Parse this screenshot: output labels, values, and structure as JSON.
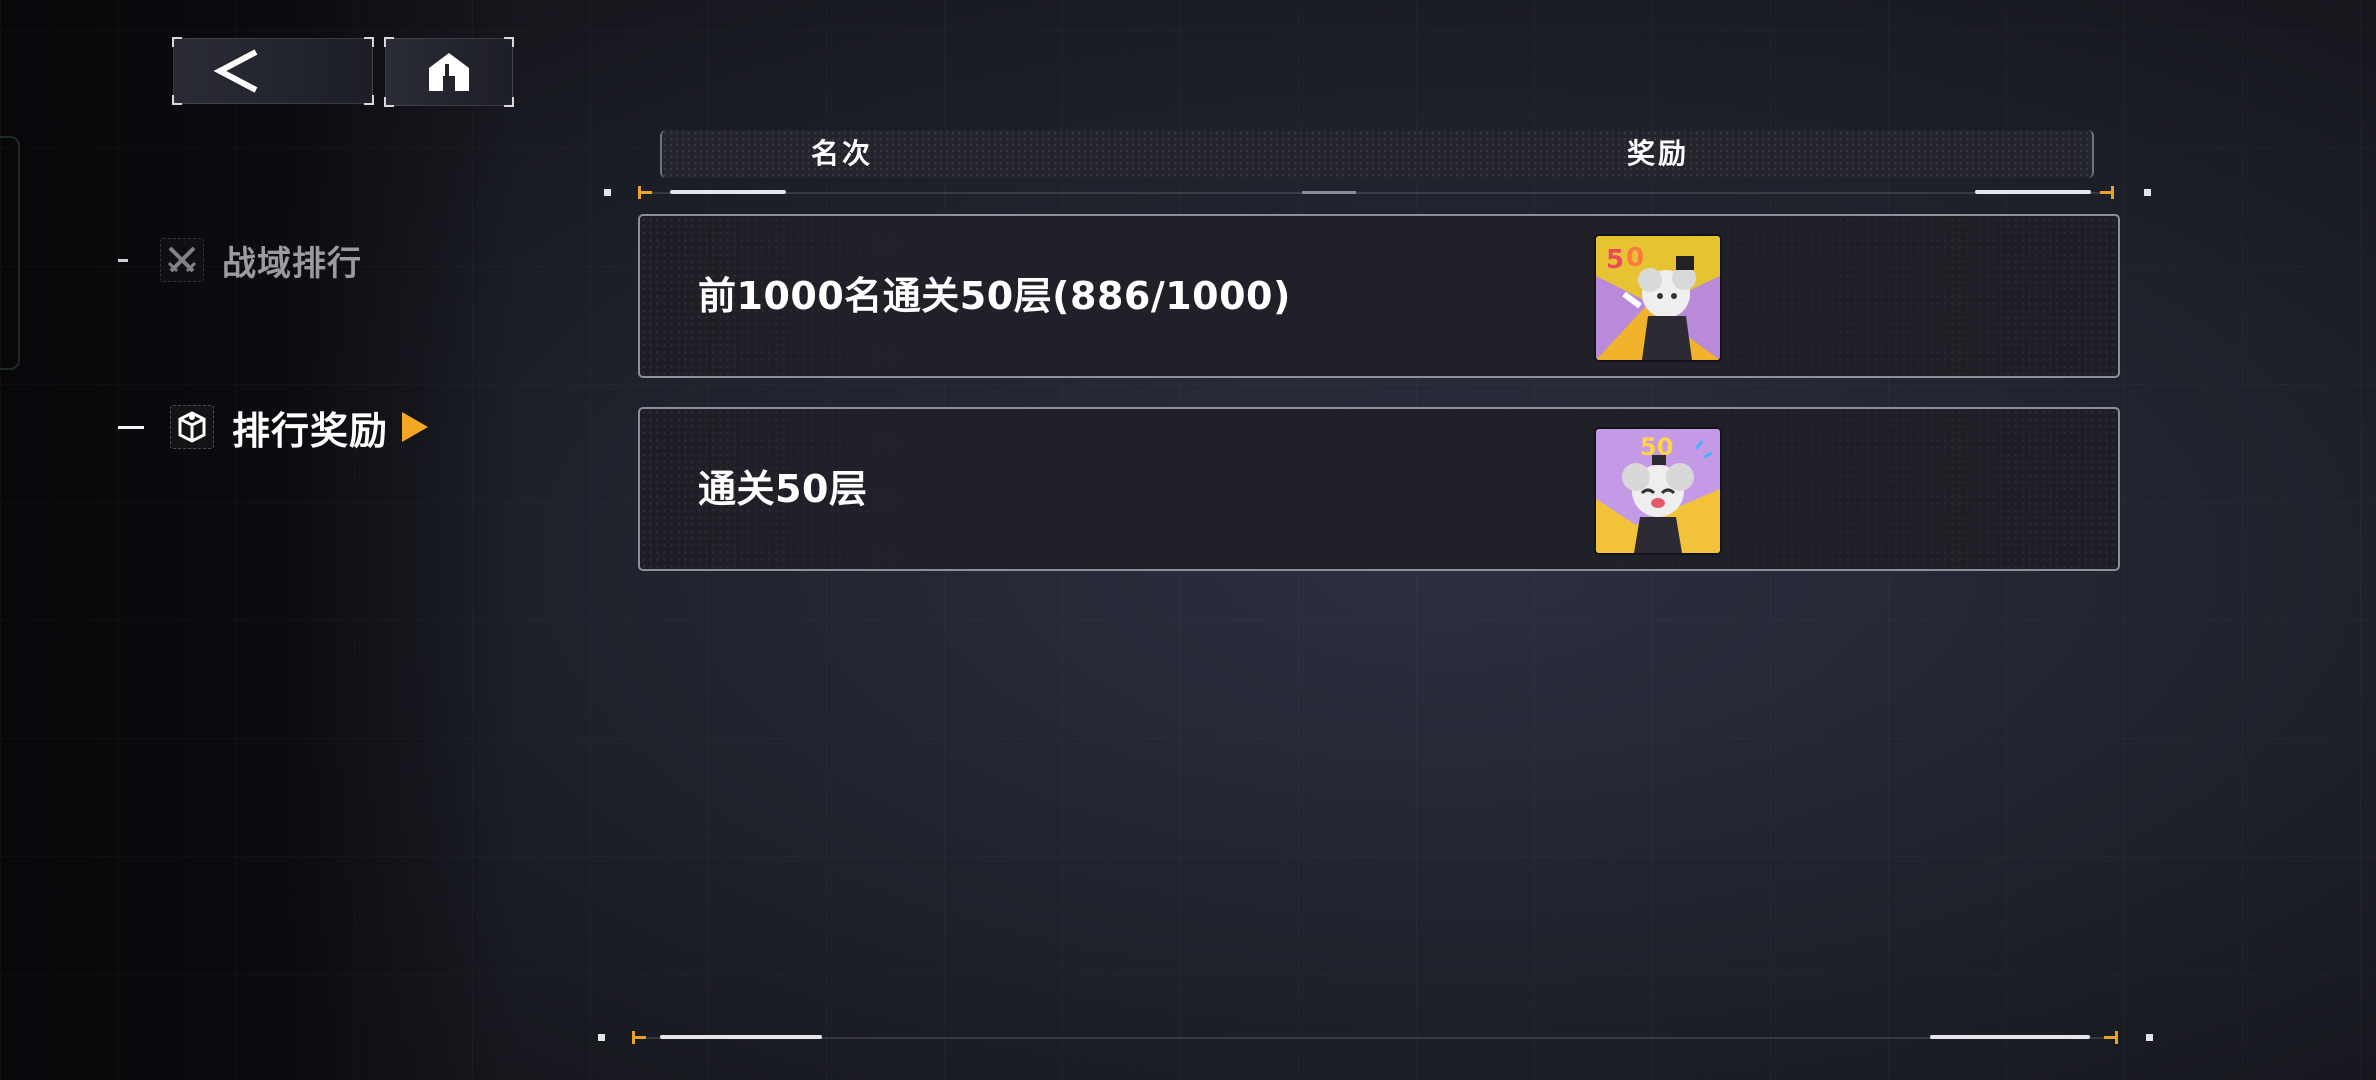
{
  "nav": {
    "back_icon": "back-chevron-icon",
    "home_icon": "home-icon"
  },
  "sidebar": {
    "items": [
      {
        "label": "战域排行",
        "icon": "crossed-swords-icon",
        "active": false
      },
      {
        "label": "排行奖励",
        "icon": "gift-box-icon",
        "active": true
      }
    ]
  },
  "table": {
    "header_rank": "名次",
    "header_reward": "奖励",
    "rows": [
      {
        "label": "前1000名通关50层(886/1000)",
        "reward_icon": "chibi-avatar-frame-reward-icon"
      },
      {
        "label": "通关50层",
        "reward_icon": "chibi-avatar-frame-reward-icon"
      }
    ]
  },
  "colors": {
    "accent": "#f2a825",
    "text_primary": "#ffffff",
    "text_dim": "#9a9aa0",
    "row_border": "#8e8f98"
  }
}
